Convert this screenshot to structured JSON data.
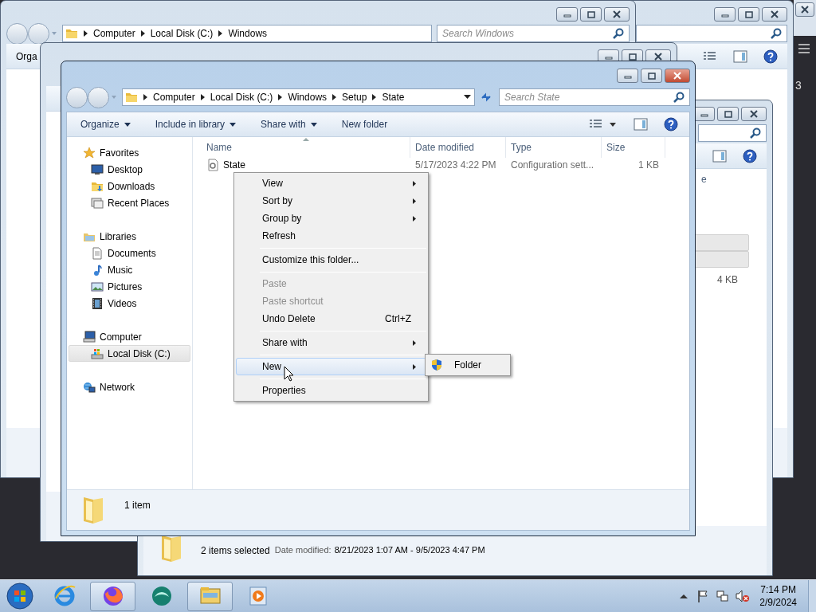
{
  "background_windows": [
    {
      "kind": "dark",
      "fragment": "3"
    },
    {
      "kind": "explorer"
    },
    {
      "kind": "explorer",
      "address": [
        "Computer",
        "Local Disk (C:)",
        "Windows"
      ],
      "search_placeholder": "Search Windows",
      "toolbar_fragment": "Orga"
    },
    {
      "kind": "explorer"
    },
    {
      "kind": "explorer",
      "header_fragment": "e",
      "size": "4 KB",
      "status": "2 items selected",
      "detail_label": "Date modified:",
      "detail": "8/21/2023 1:07 AM - 9/5/2023 4:47 PM"
    }
  ],
  "window": {
    "address": [
      "Computer",
      "Local Disk (C:)",
      "Windows",
      "Setup",
      "State"
    ],
    "search": {
      "placeholder": "Search State"
    },
    "toolbar": [
      {
        "label": "Organize",
        "dropdown": true
      },
      {
        "label": "Include in library",
        "dropdown": true
      },
      {
        "label": "Share with",
        "dropdown": true
      },
      {
        "label": "New folder",
        "dropdown": false
      }
    ],
    "navigation": [
      {
        "label": "Favorites",
        "kind": "favorites",
        "selected": false,
        "children": [
          {
            "label": "Desktop",
            "kind": "desktop",
            "selected": false
          },
          {
            "label": "Downloads",
            "kind": "downloads",
            "selected": false
          },
          {
            "label": "Recent Places",
            "kind": "recent",
            "selected": false
          }
        ]
      },
      {
        "label": "Libraries",
        "kind": "libraries",
        "selected": false,
        "children": [
          {
            "label": "Documents",
            "kind": "documents",
            "selected": false
          },
          {
            "label": "Music",
            "kind": "music",
            "selected": false
          },
          {
            "label": "Pictures",
            "kind": "pictures",
            "selected": false
          },
          {
            "label": "Videos",
            "kind": "videos",
            "selected": false
          }
        ]
      },
      {
        "label": "Computer",
        "kind": "computer",
        "selected": false,
        "children": [
          {
            "label": "Local Disk (C:)",
            "kind": "disk",
            "selected": true
          }
        ]
      },
      {
        "label": "Network",
        "kind": "network",
        "selected": false
      }
    ],
    "columns": [
      "Name",
      "Date modified",
      "Type",
      "Size"
    ],
    "files": [
      {
        "name": "State",
        "date_modified": "5/17/2023 4:22 PM",
        "type": "Configuration sett...",
        "size": "1 KB"
      }
    ],
    "status_bar": {
      "count": "1 item"
    }
  },
  "context_menu": {
    "items": [
      {
        "kind": "item",
        "label": "View",
        "submenu": true,
        "disabled": false,
        "highlighted": false
      },
      {
        "kind": "item",
        "label": "Sort by",
        "submenu": true,
        "disabled": false,
        "highlighted": false
      },
      {
        "kind": "item",
        "label": "Group by",
        "submenu": true,
        "disabled": false,
        "highlighted": false
      },
      {
        "kind": "item",
        "label": "Refresh",
        "submenu": false,
        "disabled": false,
        "highlighted": false
      },
      {
        "kind": "separator"
      },
      {
        "kind": "item",
        "label": "Customize this folder...",
        "submenu": false,
        "disabled": false,
        "highlighted": false
      },
      {
        "kind": "separator"
      },
      {
        "kind": "item",
        "label": "Paste",
        "submenu": false,
        "disabled": true,
        "highlighted": false
      },
      {
        "kind": "item",
        "label": "Paste shortcut",
        "submenu": false,
        "disabled": true,
        "highlighted": false
      },
      {
        "kind": "item",
        "label": "Undo Delete",
        "shortcut": "Ctrl+Z",
        "submenu": false,
        "disabled": false,
        "highlighted": false
      },
      {
        "kind": "separator"
      },
      {
        "kind": "item",
        "label": "Share with",
        "submenu": true,
        "disabled": false,
        "highlighted": false
      },
      {
        "kind": "separator"
      },
      {
        "kind": "item",
        "label": "New",
        "submenu": true,
        "disabled": false,
        "highlighted": true
      },
      {
        "kind": "separator"
      },
      {
        "kind": "item",
        "label": "Properties",
        "submenu": false,
        "disabled": false,
        "highlighted": false
      }
    ]
  },
  "submenu": {
    "items": [
      {
        "label": "Folder"
      }
    ]
  },
  "taskbar": {
    "apps": [
      {
        "kind": "ie",
        "running": false
      },
      {
        "kind": "firefox",
        "running": true
      },
      {
        "kind": "teal",
        "running": false
      },
      {
        "kind": "explorer",
        "running": true
      },
      {
        "kind": "media",
        "running": false
      }
    ],
    "clock": {
      "time": "7:14 PM",
      "date": "2/9/2024"
    }
  }
}
